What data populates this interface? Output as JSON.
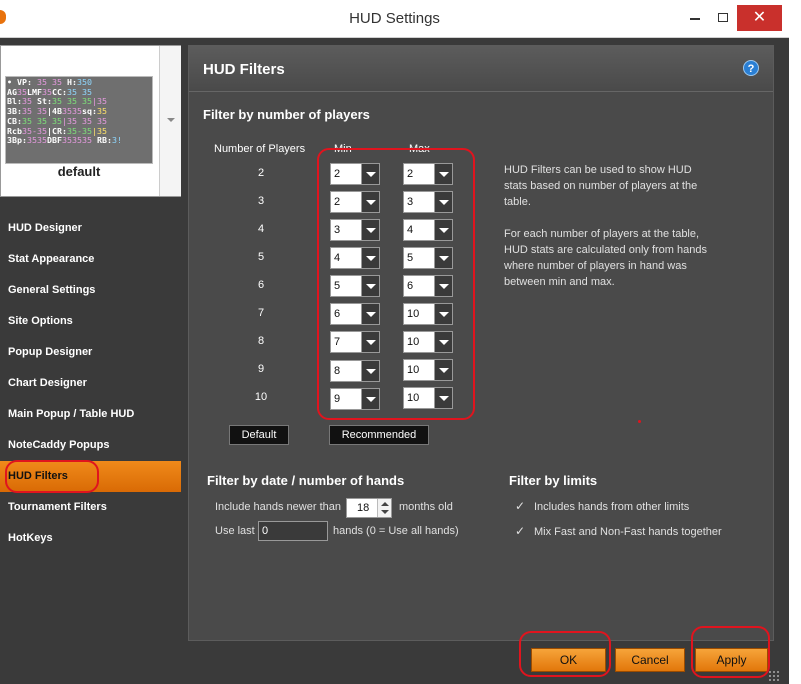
{
  "window": {
    "title": "HUD Settings",
    "minimize_icon": "minimize-icon",
    "maximize_icon": "maximize-icon",
    "close_label": "✕"
  },
  "preview": {
    "name": "default",
    "lines": [
      [
        "• VP:",
        "35",
        "35",
        "H:",
        "350"
      ],
      [
        "AG",
        "35",
        "LMF",
        "35",
        "CC:",
        "35",
        "35"
      ],
      [
        "Bl:",
        "35",
        "St:",
        "35",
        "35",
        "35",
        "|35"
      ],
      [
        "3B:",
        "35",
        "35",
        "|4B",
        "35",
        "35",
        "sq:",
        "35"
      ],
      [
        "CB:",
        "35",
        "35",
        "35",
        "|35",
        "35",
        "35"
      ],
      [
        "Rcb",
        "35-",
        "35",
        "|CR:",
        "35-",
        "35",
        "|35"
      ],
      [
        "3Bp:",
        "35",
        "35",
        "DBF",
        "35",
        "35",
        "35",
        "RB:",
        "3!"
      ]
    ]
  },
  "sidebar": {
    "items": [
      {
        "label": "HUD Designer",
        "active": false
      },
      {
        "label": "Stat Appearance",
        "active": false
      },
      {
        "label": "General Settings",
        "active": false
      },
      {
        "label": "Site Options",
        "active": false
      },
      {
        "label": "Popup Designer",
        "active": false
      },
      {
        "label": "Chart Designer",
        "active": false
      },
      {
        "label": "Main Popup / Table HUD",
        "active": false
      },
      {
        "label": "NoteCaddy Popups",
        "active": false
      },
      {
        "label": "HUD Filters",
        "active": true
      },
      {
        "label": "Tournament Filters",
        "active": false
      },
      {
        "label": "HotKeys",
        "active": false
      }
    ]
  },
  "panel": {
    "title": "HUD Filters",
    "help_label": "?",
    "players_section": {
      "title": "Filter by number of players",
      "col_players": "Number of Players",
      "col_min": "Min",
      "col_max": "Max",
      "rows": [
        {
          "players": "2",
          "min": "2",
          "max": "2"
        },
        {
          "players": "3",
          "min": "2",
          "max": "3"
        },
        {
          "players": "4",
          "min": "3",
          "max": "4"
        },
        {
          "players": "5",
          "min": "4",
          "max": "5"
        },
        {
          "players": "6",
          "min": "5",
          "max": "6"
        },
        {
          "players": "7",
          "min": "6",
          "max": "10"
        },
        {
          "players": "8",
          "min": "7",
          "max": "10"
        },
        {
          "players": "9",
          "min": "8",
          "max": "10"
        },
        {
          "players": "10",
          "min": "9",
          "max": "10"
        }
      ],
      "default_button": "Default",
      "recommended_button": "Recommended",
      "info_1": "HUD Filters can be used to show HUD stats based on number of players at the table.",
      "info_2": "For each number of players at the table, HUD stats are calculated only from hands where number of players in hand was between min and max."
    },
    "date_section": {
      "title": "Filter by date / number of hands",
      "newer_label": "Include hands newer than",
      "newer_value": "18",
      "newer_unit": "months old",
      "last_label": "Use last",
      "last_value": "0",
      "last_unit": "hands (0 = Use all hands)"
    },
    "limits_section": {
      "title": "Filter by limits",
      "check_1": "Includes hands from other limits",
      "check_2": "Mix Fast and Non-Fast hands together",
      "check_mark": "✓"
    }
  },
  "footer": {
    "ok": "OK",
    "cancel": "Cancel",
    "apply": "Apply"
  }
}
